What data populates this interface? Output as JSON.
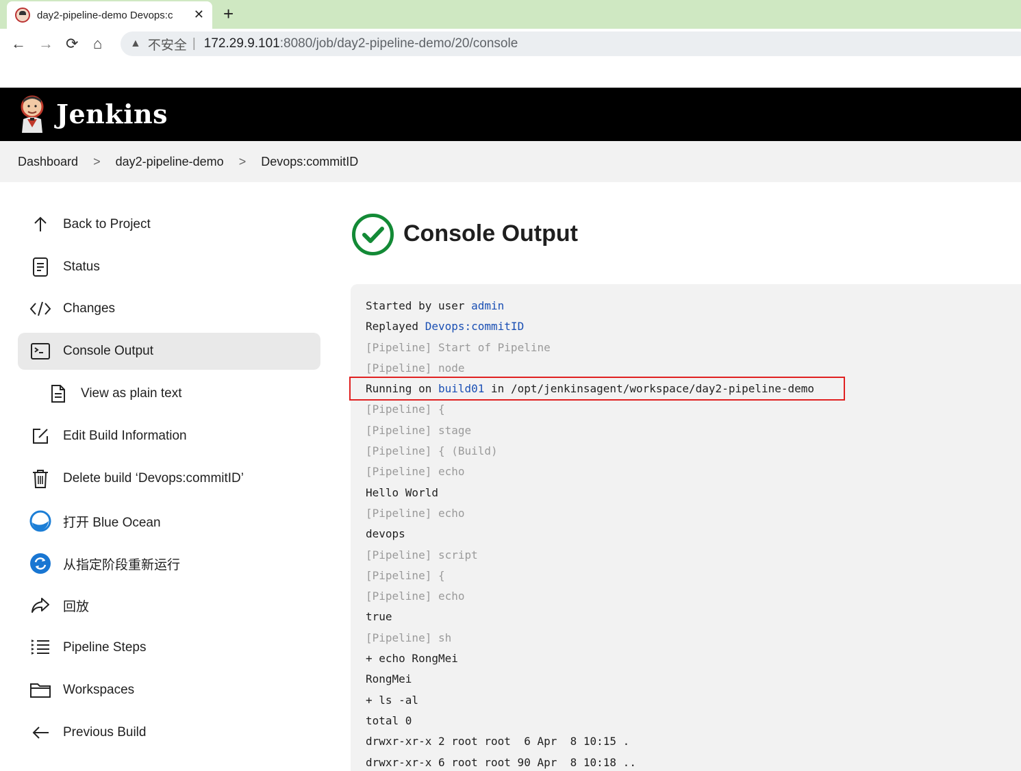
{
  "browser": {
    "tab_title": "day2-pipeline-demo Devops:c",
    "tab_close": "✕",
    "new_tab": "+",
    "back": "←",
    "forward": "→",
    "reload": "⟳",
    "home": "⌂",
    "warning": "▲",
    "insecure": "不安全",
    "separator": "|",
    "url_host": "172.29.9.101",
    "url_path": ":8080/job/day2-pipeline-demo/20/console"
  },
  "header": {
    "brand": "Jenkins"
  },
  "breadcrumbs": {
    "items": [
      "Dashboard",
      "day2-pipeline-demo",
      "Devops:commitID"
    ],
    "separator": ">"
  },
  "sidebar": {
    "items": [
      {
        "label": "Back to Project"
      },
      {
        "label": "Status"
      },
      {
        "label": "Changes"
      },
      {
        "label": "Console Output"
      },
      {
        "label": "View as plain text"
      },
      {
        "label": "Edit Build Information"
      },
      {
        "label": "Delete build ‘Devops:commitID’"
      },
      {
        "label": "打开 Blue Ocean"
      },
      {
        "label": "从指定阶段重新运行"
      },
      {
        "label": "回放"
      },
      {
        "label": "Pipeline Steps"
      },
      {
        "label": "Workspaces"
      },
      {
        "label": "Previous Build"
      }
    ]
  },
  "main": {
    "title": "Console Output"
  },
  "console": {
    "lines": [
      {
        "pre": "Started by user ",
        "link": "admin",
        "post": ""
      },
      {
        "pre": "Replayed ",
        "link": "Devops:commitID",
        "post": ""
      },
      {
        "dim": "[Pipeline] ",
        "text": "Start of Pipeline"
      },
      {
        "dim": "[Pipeline] ",
        "text": "node"
      },
      {
        "pre": "Running on ",
        "link": "build01",
        "post": " in /opt/jenkinsagent/workspace/day2-pipeline-demo"
      },
      {
        "dim": "[Pipeline] ",
        "text": "{"
      },
      {
        "dim": "[Pipeline] ",
        "text": "stage"
      },
      {
        "dim": "[Pipeline] ",
        "text": "{ (Build)"
      },
      {
        "dim": "[Pipeline] ",
        "text": "echo"
      },
      {
        "plain": "Hello World"
      },
      {
        "dim": "[Pipeline] ",
        "text": "echo"
      },
      {
        "plain": "devops"
      },
      {
        "dim": "[Pipeline] ",
        "text": "script"
      },
      {
        "dim": "[Pipeline] ",
        "text": "{"
      },
      {
        "dim": "[Pipeline] ",
        "text": "echo"
      },
      {
        "plain": "true"
      },
      {
        "dim": "[Pipeline] ",
        "text": "sh"
      },
      {
        "plain": "+ echo RongMei"
      },
      {
        "plain": "RongMei"
      },
      {
        "plain": "+ ls -al"
      },
      {
        "plain": "total 0"
      },
      {
        "plain": "drwxr-xr-x 2 root root  6 Apr  8 10:15 ."
      },
      {
        "plain": "drwxr-xr-x 6 root root 90 Apr  8 10:18 .."
      }
    ]
  },
  "colors": {
    "tabstrip": "#cfe8c2",
    "header": "#000000",
    "success": "#138a36",
    "link": "#1a4fb4",
    "highlight": "#e02020"
  }
}
